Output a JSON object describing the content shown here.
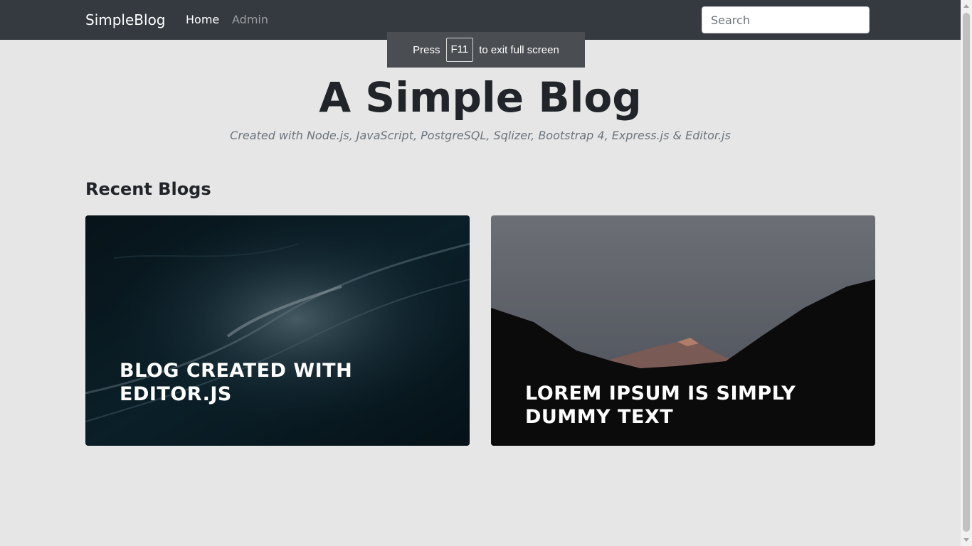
{
  "navbar": {
    "brand": "SimpleBlog",
    "links": [
      {
        "label": "Home"
      },
      {
        "label": "Admin"
      }
    ],
    "search": {
      "placeholder": "Search",
      "value": ""
    }
  },
  "fullscreen_notice": {
    "before": "Press",
    "key": "F11",
    "after": "to exit full screen"
  },
  "hero": {
    "title": "A Simple Blog",
    "subtitle": "Created with Node.js, JavaScript, PostgreSQL, Sqlizer, Bootstrap 4, Express.js & Editor.js"
  },
  "recent": {
    "heading": "Recent Blogs",
    "posts": [
      {
        "title": "BLOG CREATED WITH EDITOR.JS",
        "image": "ocean-waves"
      },
      {
        "title": "LOREM IPSUM IS SIMPLY DUMMY TEXT",
        "image": "mountain-silhouette"
      }
    ]
  },
  "colors": {
    "navbar": "#343a40",
    "background": "#e6e6e6",
    "text": "#212529",
    "muted": "#6c757d"
  }
}
